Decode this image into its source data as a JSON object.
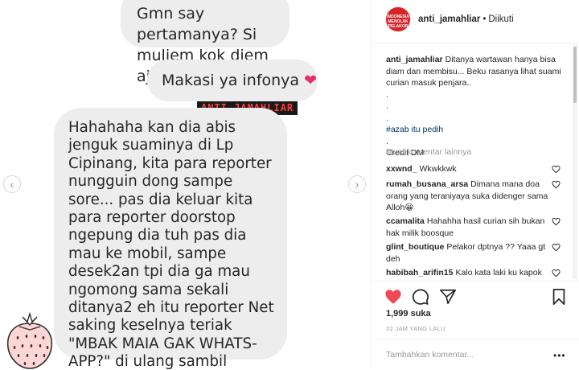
{
  "post": {
    "bubbles": [
      {
        "text": "Gmn say pertamanya? Si\nmuljem kok diem aja?"
      },
      {
        "text": "Makasi ya infonya"
      },
      {
        "text": "Hahahaha kan dia abis jenguk suaminya di Lp Cipinang, kita para reporter nungguin dong sampe sore... pas dia keluar kita para reporter doorstop ngepung dia tuh pas dia mau ke mobil, sampe desek2an tpi dia ga mau ngomong sama sekali ditanya2 eh itu reporter Net saking keselnya teriak \"MBAK MAIA GAK WHATS-APP?\" di ulang sambil masang muka kesel hahahahaha"
      }
    ],
    "watermark": "ANTI JAMAHLIAR",
    "heart_emoji": "❤"
  },
  "header": {
    "avatar_text": "INDONESIA MENOLAK PELAKOR",
    "username": "anti_jamahliar",
    "separator": "•",
    "follow_status": "Diikuti"
  },
  "caption": {
    "username": "anti_jamahliar",
    "text": "Ditanya wartawan hanya bisa diam dan membisu... Beku rasanya lihat suami curian masuk penjara..",
    "lines": [
      ".",
      ".",
      ".",
      "#azab itu pedih",
      ".",
      "Credit DM"
    ]
  },
  "more_comments_label": "Muat komentar lainnya",
  "comments": [
    {
      "username": "xxwnd_",
      "text": "Wkwkkwk"
    },
    {
      "username": "rumah_busana_arsa",
      "text": "Dimana mana doa orang yang teraniyaya suka didenger sama Alloh😀"
    },
    {
      "username": "ccamalita",
      "text": "Hahahha hasil curian sih bukan hak milik boosque"
    },
    {
      "username": "glint_boutique",
      "text": "Pelakor dptnya ?? Yaaa gt deh"
    },
    {
      "username": "habibah_arifin15",
      "text": "Kalo kata laki ku kapok"
    }
  ],
  "likes": "1,999 suka",
  "time": "22 JAM YANG LALU",
  "add_comment_placeholder": "Tambahkan komentar...",
  "more_options": "•••",
  "colors": {
    "like_red": "#ed4956",
    "hashtag": "#003569",
    "muted": "#999999"
  }
}
